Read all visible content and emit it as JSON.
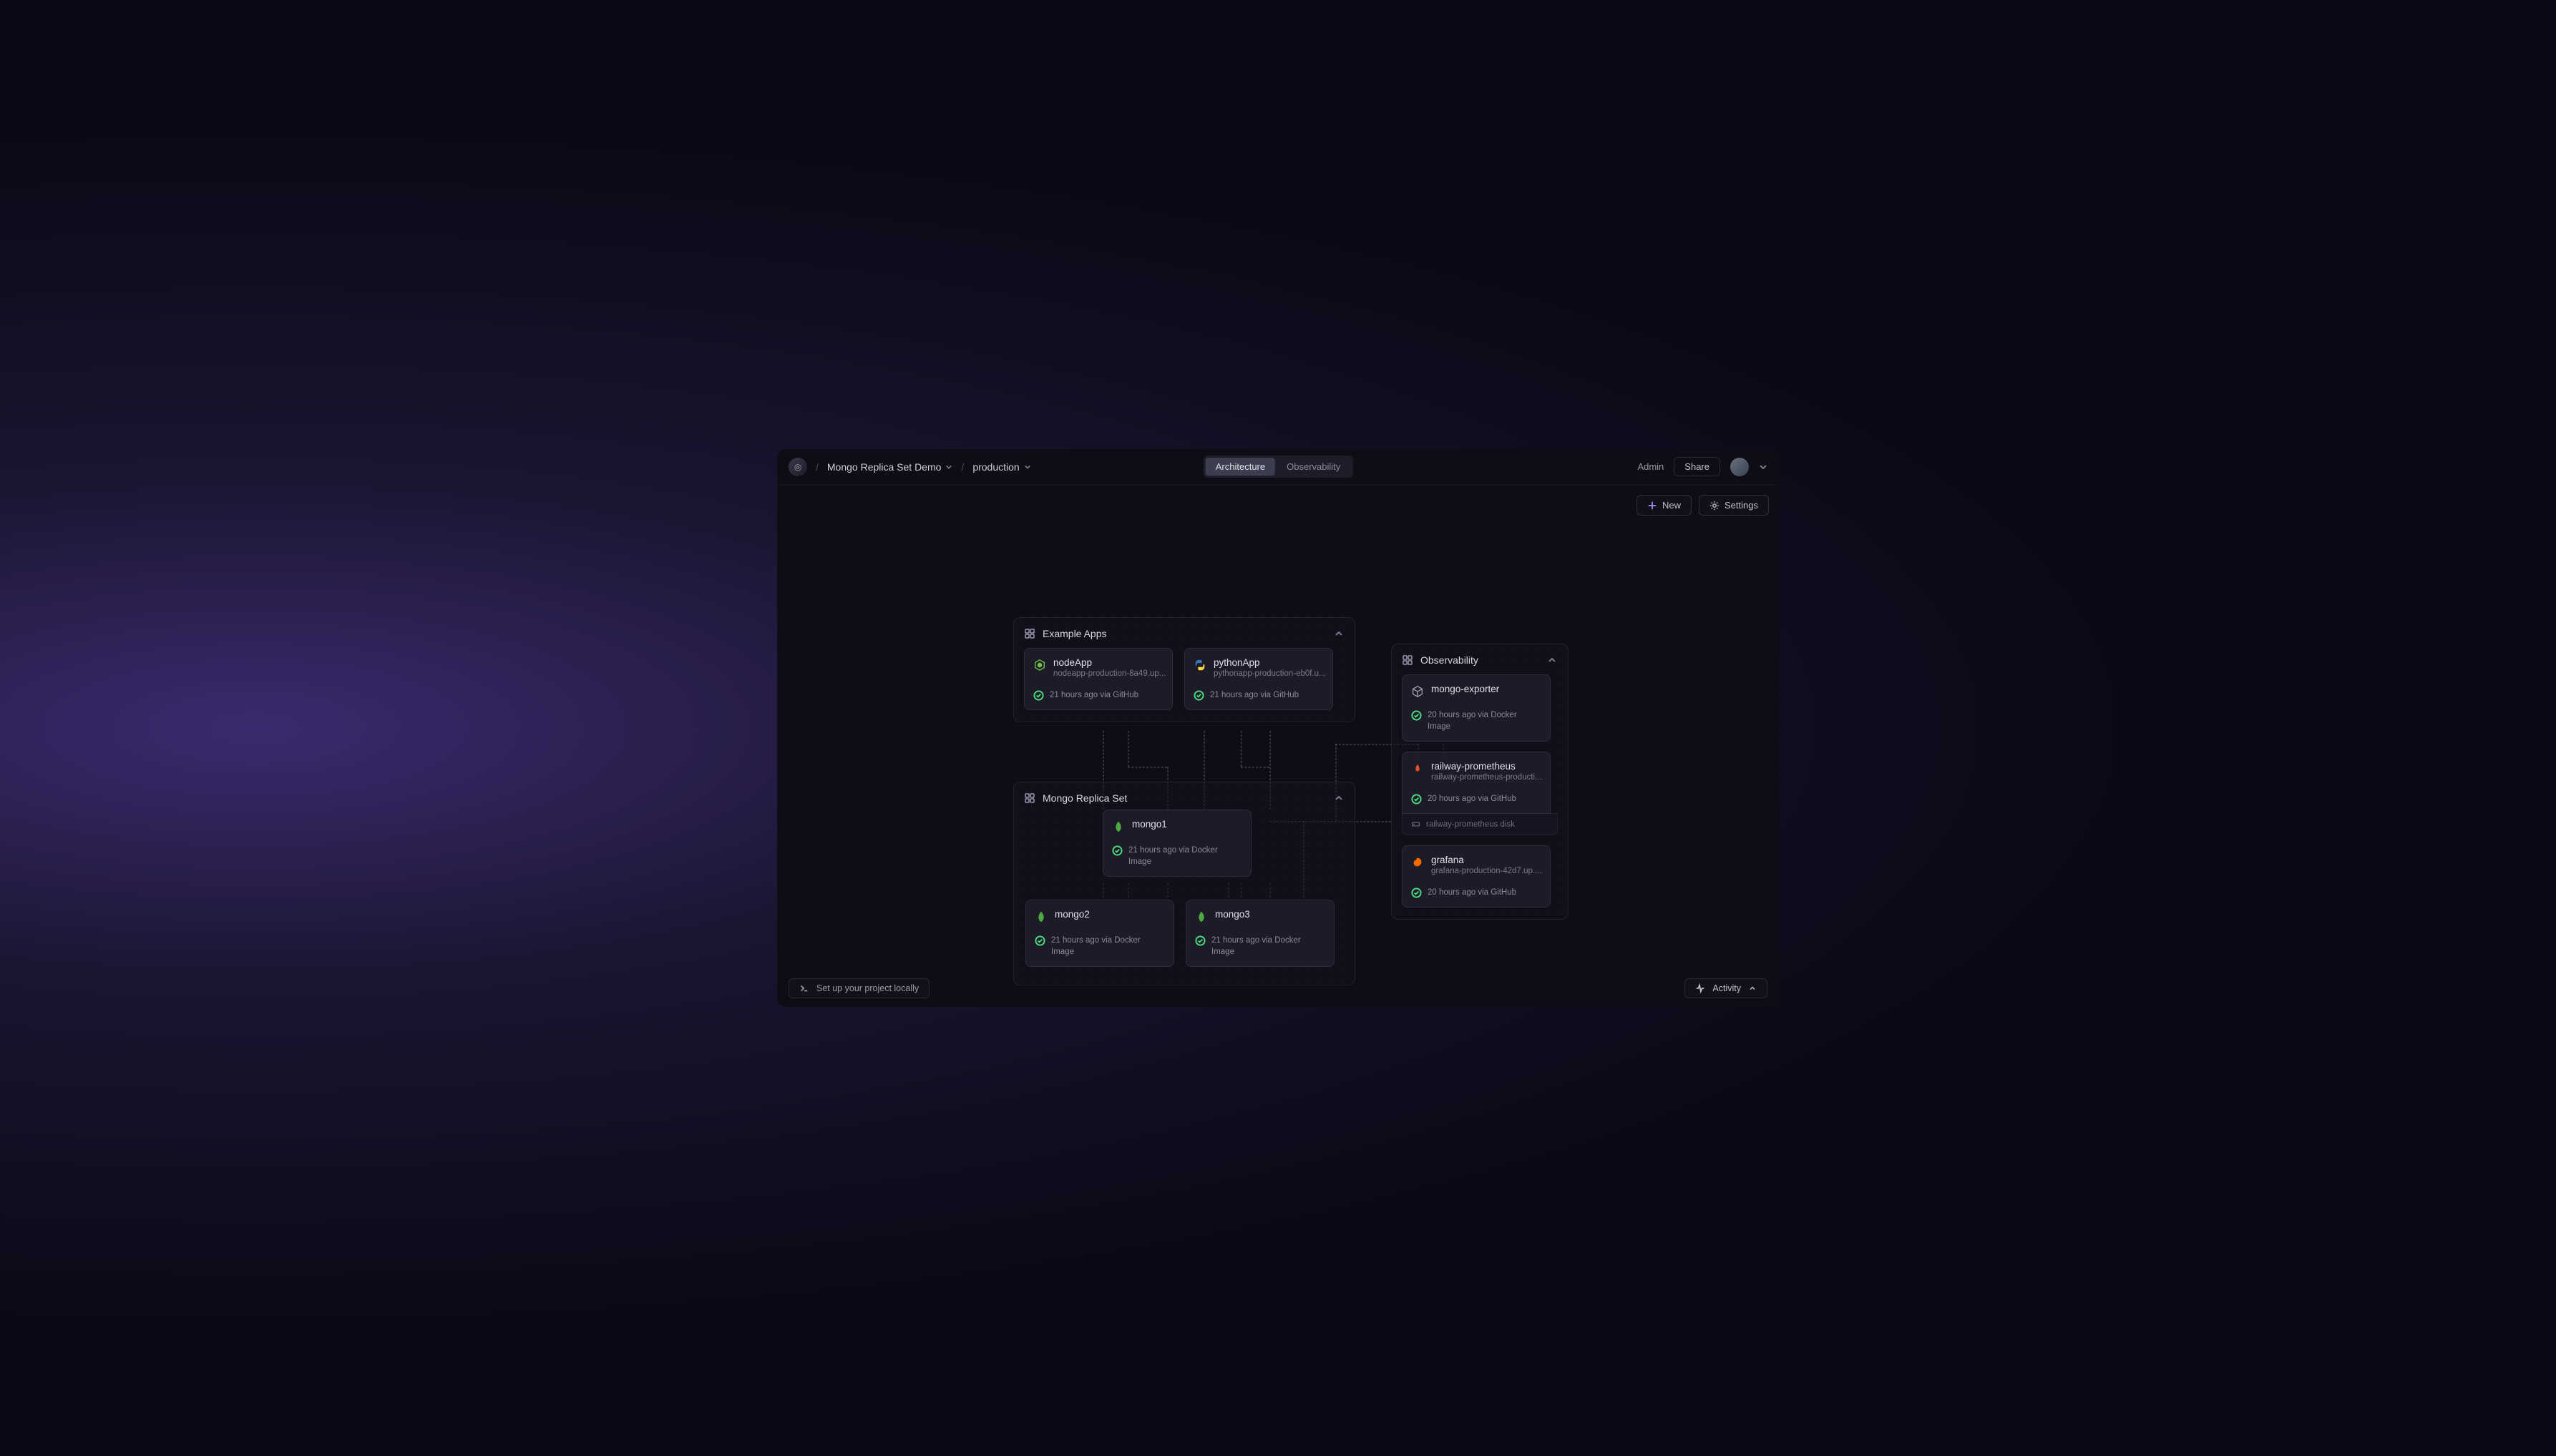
{
  "breadcrumb": {
    "project": "Mongo Replica Set Demo",
    "env": "production"
  },
  "tabs": {
    "architecture": "Architecture",
    "observability": "Observability"
  },
  "topRight": {
    "admin": "Admin",
    "share": "Share"
  },
  "toolbar": {
    "new": "New",
    "settings": "Settings"
  },
  "groups": {
    "apps": {
      "title": "Example Apps"
    },
    "mongo": {
      "title": "Mongo Replica Set"
    },
    "obs": {
      "title": "Observability"
    }
  },
  "services": {
    "nodeApp": {
      "name": "nodeApp",
      "url": "nodeapp-production-8a49.up...",
      "status": "21 hours ago via GitHub"
    },
    "pythonApp": {
      "name": "pythonApp",
      "url": "pythonapp-production-eb0f.u...",
      "status": "21 hours ago via GitHub"
    },
    "mongo1": {
      "name": "mongo1",
      "status": "21 hours ago via Docker Image"
    },
    "mongo2": {
      "name": "mongo2",
      "status": "21 hours ago via Docker Image"
    },
    "mongo3": {
      "name": "mongo3",
      "status": "21 hours ago via Docker Image"
    },
    "mongoExporter": {
      "name": "mongo-exporter",
      "status": "20 hours ago via Docker Image"
    },
    "prometheus": {
      "name": "railway-prometheus",
      "url": "railway-prometheus-producti...",
      "status": "20 hours ago via GitHub",
      "disk": "railway-prometheus disk"
    },
    "grafana": {
      "name": "grafana",
      "url": "grafana-production-42d7.up....",
      "status": "20 hours ago via GitHub"
    }
  },
  "footer": {
    "setup": "Set up your project locally",
    "activity": "Activity"
  }
}
